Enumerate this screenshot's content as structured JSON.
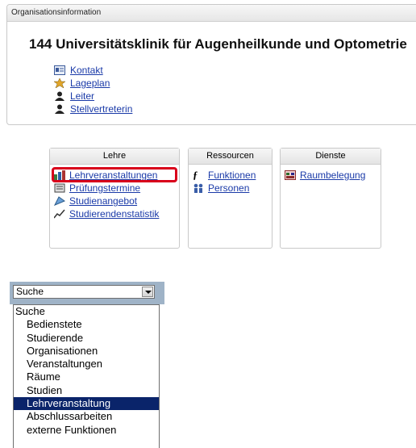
{
  "org_panel": {
    "header": "Organisationsinformation",
    "title": "144 Universitätsklinik für Augenheilkunde und Optometrie",
    "links": [
      {
        "label": "Kontakt",
        "icon": "contact-card-icon"
      },
      {
        "label": "Lageplan",
        "icon": "location-pin-icon"
      },
      {
        "label": "Leiter",
        "icon": "person-icon"
      },
      {
        "label": "Stellvertreterin",
        "icon": "person-icon"
      }
    ]
  },
  "boxes": {
    "lehre": {
      "header": "Lehre",
      "items": [
        {
          "label": "Lehrveranstaltungen",
          "icon": "courses-icon"
        },
        {
          "label": "Prüfungstermine",
          "icon": "exam-dates-icon"
        },
        {
          "label": "Studienangebot",
          "icon": "study-program-icon"
        },
        {
          "label": "Studierendenstatistik",
          "icon": "statistics-icon"
        }
      ]
    },
    "ressourcen": {
      "header": "Ressourcen",
      "items": [
        {
          "label": "Funktionen",
          "icon": "function-icon"
        },
        {
          "label": "Personen",
          "icon": "people-icon"
        }
      ]
    },
    "dienste": {
      "header": "Dienste",
      "items": [
        {
          "label": "Raumbelegung",
          "icon": "room-booking-icon"
        }
      ]
    }
  },
  "search_dropdown": {
    "selected": "Suche",
    "options": [
      {
        "label": "Suche",
        "indent": false,
        "selected": false
      },
      {
        "label": "Bedienstete",
        "indent": true,
        "selected": false
      },
      {
        "label": "Studierende",
        "indent": true,
        "selected": false
      },
      {
        "label": "Organisationen",
        "indent": true,
        "selected": false
      },
      {
        "label": "Veranstaltungen",
        "indent": true,
        "selected": false
      },
      {
        "label": "Räume",
        "indent": true,
        "selected": false
      },
      {
        "label": "Studien",
        "indent": true,
        "selected": false
      },
      {
        "label": "Lehrveranstaltung",
        "indent": true,
        "selected": true
      },
      {
        "label": "Abschlussarbeiten",
        "indent": true,
        "selected": false
      },
      {
        "label": "externe Funktionen",
        "indent": true,
        "selected": false
      }
    ]
  },
  "colors": {
    "link": "#1a3aa8",
    "highlight": "#d9001b",
    "selected_option": "#0a246a",
    "dropdown_bar": "#9fb3c7"
  }
}
